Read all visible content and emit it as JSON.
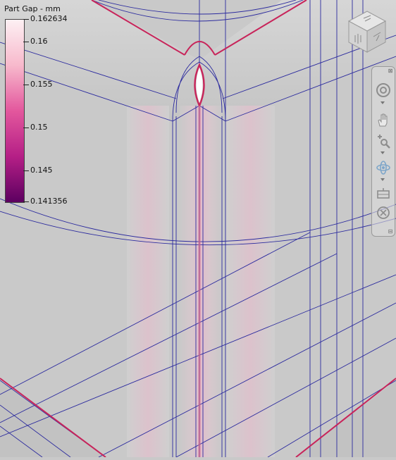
{
  "legend": {
    "title": "Part Gap - mm",
    "ticks": [
      {
        "label": "0.162634",
        "pos": 0.0
      },
      {
        "label": "0.16",
        "pos": 0.1241
      },
      {
        "label": "0.155",
        "pos": 0.3595
      },
      {
        "label": "0.15",
        "pos": 0.5948
      },
      {
        "label": "0.145",
        "pos": 0.8301
      },
      {
        "label": "0.141356",
        "pos": 1.0
      }
    ],
    "colors": {
      "max": "#fdf0f3",
      "high": "#f7b9cc",
      "mid": "#e3579d",
      "low": "#b51f86",
      "min": "#5c0060"
    }
  },
  "viewcube": {
    "faces": [
      "top",
      "front",
      "right"
    ]
  },
  "navbar": {
    "tools": [
      {
        "name": "steering-wheel",
        "icon": "steering-wheel-icon"
      },
      {
        "name": "pan",
        "icon": "hand-icon"
      },
      {
        "name": "zoom",
        "icon": "zoom-icon"
      },
      {
        "name": "orbit",
        "icon": "orbit-icon"
      },
      {
        "name": "look-at",
        "icon": "look-at-icon"
      },
      {
        "name": "show-motion",
        "icon": "show-motion-icon"
      }
    ],
    "close_glyph": "⊠",
    "minimize_glyph": "⊟"
  },
  "scene": {
    "wire_color": "#2b2a9e",
    "edge_highlight": "#c8245a",
    "surface_color": "#c9c9c9"
  }
}
